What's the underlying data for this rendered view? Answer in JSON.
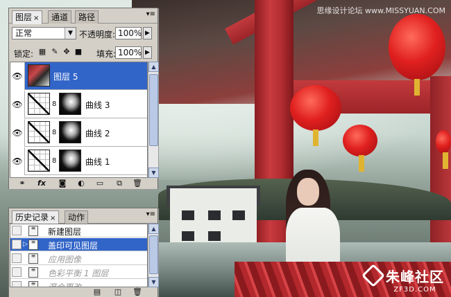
{
  "photo": {
    "watermark_top": "思缘设计论坛 www.MISSYUAN.COM",
    "watermark_brand_cn": "朱峰社区",
    "watermark_brand_en": "ZF3D.COM"
  },
  "layers_panel": {
    "tabs": [
      {
        "label": "图层",
        "close": "×"
      },
      {
        "label": "通道"
      },
      {
        "label": "路径"
      }
    ],
    "menu_glyph": "▾≡",
    "blend_mode": "正常",
    "opacity_label": "不透明度:",
    "opacity_value": "100%",
    "lock_label": "锁定:",
    "fill_label": "填充:",
    "fill_value": "100%",
    "layers": [
      {
        "name": "图层 5",
        "selected": true,
        "visible": true
      },
      {
        "name": "曲线 3",
        "selected": false,
        "visible": true
      },
      {
        "name": "曲线 2",
        "selected": false,
        "visible": true
      },
      {
        "name": "曲线 1",
        "selected": false,
        "visible": true
      }
    ],
    "footer_icons": [
      "link-icon",
      "fx-icon",
      "mask-icon",
      "adjustment-icon",
      "group-icon",
      "new-layer-icon",
      "trash-icon"
    ]
  },
  "history_panel": {
    "tabs": [
      {
        "label": "历史记录",
        "close": "×"
      },
      {
        "label": "动作"
      }
    ],
    "menu_glyph": "▾≡",
    "items": [
      {
        "label": "新建图层",
        "state": "normal"
      },
      {
        "label": "盖印可见图层",
        "state": "selected"
      },
      {
        "label": "应用图像",
        "state": "dim"
      },
      {
        "label": "色彩平衡 1 图层",
        "state": "dim"
      },
      {
        "label": "混合更改",
        "state": "dim"
      }
    ]
  },
  "colors": {
    "selection": "#3265c8",
    "panel_bg": "#d4d0c8"
  }
}
